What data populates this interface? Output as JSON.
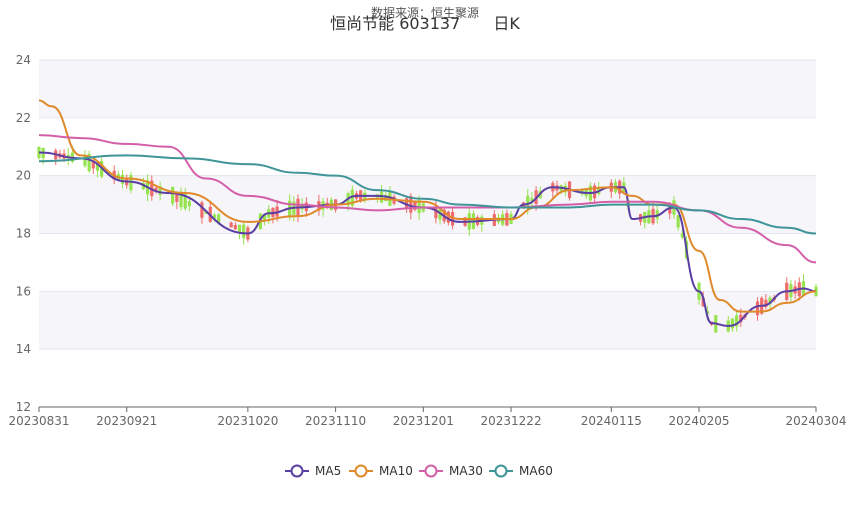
{
  "header": {
    "source_note": "数据来源：恒生聚源",
    "stock_title": "恒尚节能 603137",
    "period_label": "日K"
  },
  "chart_data": {
    "type": "line",
    "ylim": [
      12,
      24
    ],
    "y_ticks": [
      12,
      14,
      16,
      18,
      20,
      22,
      24
    ],
    "x_ticks": [
      "20230831",
      "20230921",
      "20231020",
      "20231110",
      "20231201",
      "20231222",
      "20240115",
      "20240205",
      "20240304"
    ],
    "grid": true,
    "legend_position": "bottom",
    "series": [
      {
        "name": "MA5",
        "color": "#5b3ea3",
        "x": [
          "20230831",
          "20230910",
          "20230921",
          "20231001",
          "20231020",
          "20231025",
          "20231101",
          "20231110",
          "20231115",
          "20231120",
          "20231201",
          "20231210",
          "20231222",
          "20231225",
          "20240101",
          "20240110",
          "20240115",
          "20240118",
          "20240120",
          "20240125",
          "20240130",
          "20240205",
          "20240208",
          "20240212",
          "20240220",
          "20240226",
          "20240301",
          "20240304"
        ],
        "values": [
          20.8,
          20.6,
          19.8,
          19.4,
          18.0,
          18.7,
          18.9,
          19.0,
          19.3,
          19.3,
          18.9,
          18.4,
          18.5,
          19.0,
          19.6,
          19.4,
          19.6,
          19.6,
          18.5,
          18.6,
          18.9,
          16.0,
          14.9,
          14.8,
          15.5,
          16.0,
          16.1,
          16.0
        ]
      },
      {
        "name": "MA10",
        "color": "#e0892b",
        "x": [
          "20230831",
          "20230903",
          "20230910",
          "20230921",
          "20231005",
          "20231020",
          "20231101",
          "20231110",
          "20231120",
          "20231201",
          "20231210",
          "20231222",
          "20231228",
          "20240105",
          "20240115",
          "20240120",
          "20240125",
          "20240130",
          "20240205",
          "20240210",
          "20240215",
          "20240220",
          "20240226",
          "20240304"
        ],
        "values": [
          22.6,
          22.4,
          20.7,
          19.9,
          19.4,
          18.4,
          18.6,
          19.0,
          19.2,
          19.1,
          18.5,
          18.5,
          18.9,
          19.5,
          19.6,
          19.3,
          19.0,
          19.0,
          17.4,
          15.7,
          15.3,
          15.3,
          15.6,
          16.0
        ]
      },
      {
        "name": "MA30",
        "color": "#d45fa9",
        "x": [
          "20230831",
          "20230910",
          "20230921",
          "20231001",
          "20231010",
          "20231020",
          "20231101",
          "20231110",
          "20231120",
          "20231201",
          "20231210",
          "20231222",
          "20240105",
          "20240115",
          "20240125",
          "20240205",
          "20240215",
          "20240226",
          "20240304"
        ],
        "values": [
          21.4,
          21.3,
          21.1,
          21.0,
          19.9,
          19.3,
          19.0,
          18.9,
          18.8,
          18.9,
          18.9,
          18.9,
          19.0,
          19.1,
          19.1,
          18.8,
          18.2,
          17.6,
          17.0
        ]
      },
      {
        "name": "MA60",
        "color": "#3f9598",
        "x": [
          "20230831",
          "20230921",
          "20231005",
          "20231020",
          "20231101",
          "20231110",
          "20231120",
          "20231201",
          "20231210",
          "20231222",
          "20240105",
          "20240115",
          "20240125",
          "20240205",
          "20240215",
          "20240226",
          "20240304"
        ],
        "values": [
          20.5,
          20.7,
          20.6,
          20.4,
          20.1,
          20.0,
          19.5,
          19.2,
          19.0,
          18.9,
          18.9,
          19.0,
          19.0,
          18.8,
          18.5,
          18.2,
          18.0
        ]
      }
    ],
    "candle_colors": {
      "up": "#ef6c6c",
      "down": "#97e34f"
    }
  }
}
